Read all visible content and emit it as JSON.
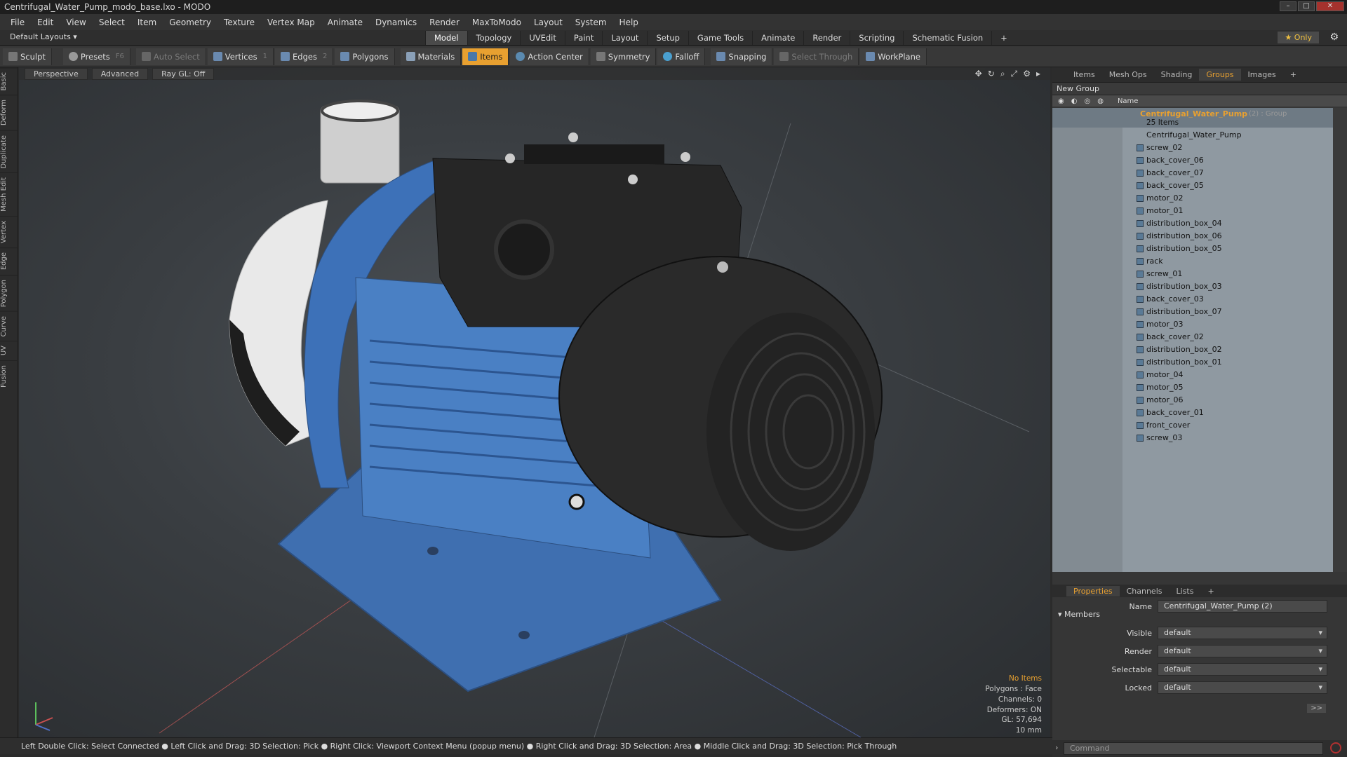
{
  "window": {
    "title": "Centrifugal_Water_Pump_modo_base.lxo - MODO"
  },
  "menu": [
    "File",
    "Edit",
    "View",
    "Select",
    "Item",
    "Geometry",
    "Texture",
    "Vertex Map",
    "Animate",
    "Dynamics",
    "Render",
    "MaxToModo",
    "Layout",
    "System",
    "Help"
  ],
  "layout": {
    "default_layouts": "Default Layouts ▾",
    "tabs": [
      "Model",
      "Topology",
      "UVEdit",
      "Paint",
      "Layout",
      "Setup",
      "Game Tools",
      "Animate",
      "Render",
      "Scripting",
      "Schematic Fusion"
    ],
    "active_tab": "Model",
    "only_label": "★ Only"
  },
  "toolbar": {
    "sculpt": "Sculpt",
    "presets": "Presets",
    "presets_key": "F6",
    "auto_select": "Auto Select",
    "vertices": "Vertices",
    "vertices_key": "1",
    "edges": "Edges",
    "edges_key": "2",
    "polygons": "Polygons",
    "materials": "Materials",
    "items": "Items",
    "action_center": "Action Center",
    "symmetry": "Symmetry",
    "falloff": "Falloff",
    "snapping": "Snapping",
    "select_through": "Select Through",
    "workplane": "WorkPlane"
  },
  "left_tabs": [
    "Basic",
    "Deform",
    "Duplicate",
    "Mesh Edit",
    "Vertex",
    "Edge",
    "Polygon",
    "Curve",
    "UV",
    "Fusion"
  ],
  "viewport": {
    "perspective": "Perspective",
    "advanced": "Advanced",
    "raygl": "Ray GL: Off",
    "info": {
      "no_items": "No Items",
      "polygons": "Polygons : Face",
      "channels": "Channels: 0",
      "deformers": "Deformers: ON",
      "gl": "GL: 57,694",
      "size": "10 mm"
    }
  },
  "statusbar": {
    "hint": "Left Double Click: Select Connected ● Left Click and Drag: 3D Selection: Pick ● Right Click: Viewport Context Menu (popup menu) ● Right Click and Drag: 3D Selection: Area ● Middle Click and Drag: 3D Selection: Pick Through"
  },
  "right_panel": {
    "tabs": [
      "Items",
      "Mesh Ops",
      "Shading",
      "Groups",
      "Images",
      "+"
    ],
    "active_tab": "Groups",
    "new_group": "New Group",
    "col_name": "Name",
    "group": {
      "name": "Centrifugal_Water_Pump",
      "suffix": "(2) : Group",
      "count": "25 Items"
    },
    "items": [
      "Centrifugal_Water_Pump",
      "screw_02",
      "back_cover_06",
      "back_cover_07",
      "back_cover_05",
      "motor_02",
      "motor_01",
      "distribution_box_04",
      "distribution_box_06",
      "distribution_box_05",
      "rack",
      "screw_01",
      "distribution_box_03",
      "back_cover_03",
      "distribution_box_07",
      "motor_03",
      "back_cover_02",
      "distribution_box_02",
      "distribution_box_01",
      "motor_04",
      "motor_05",
      "motor_06",
      "back_cover_01",
      "front_cover",
      "screw_03"
    ]
  },
  "properties": {
    "tabs": [
      "Properties",
      "Channels",
      "Lists",
      "+"
    ],
    "active_tab": "Properties",
    "name_label": "Name",
    "name_value": "Centrifugal_Water_Pump (2)",
    "members": "Members",
    "visible_label": "Visible",
    "visible": "default",
    "render_label": "Render",
    "render": "default",
    "selectable_label": "Selectable",
    "selectable": "default",
    "locked_label": "Locked",
    "locked": "default",
    "command_placeholder": "Command"
  }
}
